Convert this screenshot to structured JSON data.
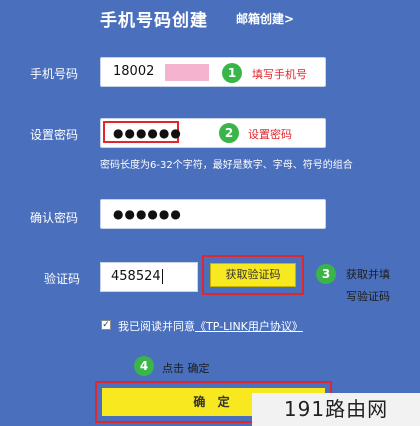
{
  "tabs": {
    "phone_create": "手机号码创建",
    "email_create": "邮箱创建>"
  },
  "phone": {
    "label": "手机号码",
    "value": "18002",
    "step": "1",
    "note": "填写手机号"
  },
  "password": {
    "label": "设置密码",
    "value_masked": "●●●●●●",
    "step": "2",
    "note": "设置密码",
    "hint": "密码长度为6-32个字符，最好是数字、字母、符号的组合"
  },
  "confirm_password": {
    "label": "确认密码",
    "value_masked": "●●●●●●"
  },
  "captcha": {
    "label": "验证码",
    "value": "458524",
    "get_code_label": "获取验证码",
    "step": "3",
    "note_line1": "获取并填",
    "note_line2": "写验证码"
  },
  "agreement": {
    "checkbox_mark": "✓",
    "text": "我已阅读并同意",
    "link": "《TP-LINK用户协议》"
  },
  "submit": {
    "step": "4",
    "note": "点击 确定",
    "label": "确 定"
  },
  "watermark": "191路由网",
  "colors": {
    "background": "#4a6fbd",
    "accent_yellow": "#f7e81f",
    "annotation_red": "#e0272e",
    "step_green": "#39b54a",
    "mask_pink": "#f6b3cf"
  }
}
